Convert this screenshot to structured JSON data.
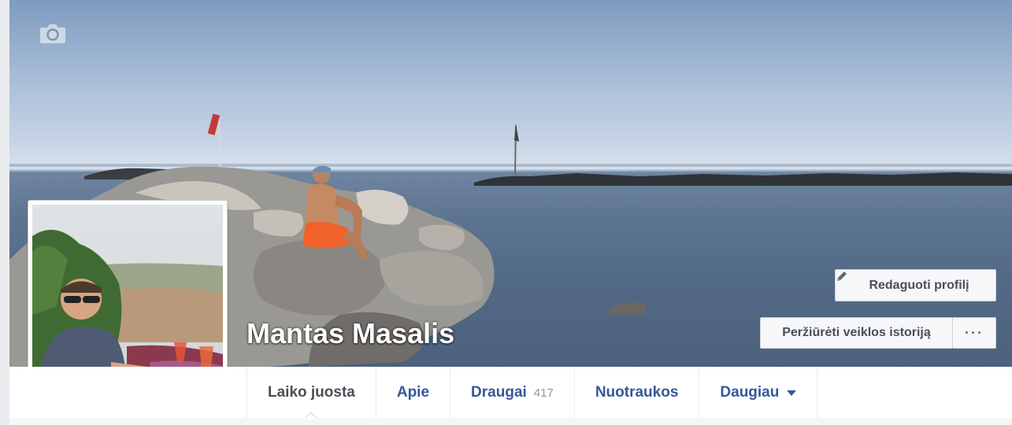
{
  "profile": {
    "name": "Mantas Masalis"
  },
  "cover": {
    "camera_icon": "camera-icon"
  },
  "actions": {
    "edit_profile_label": "Redaguoti profilį",
    "edit_icon": "pencil-icon",
    "activity_log_label": "Peržiūrėti veiklos istoriją",
    "more_label": "···"
  },
  "tabs": [
    {
      "label": "Laiko juosta",
      "active": true
    },
    {
      "label": "Apie"
    },
    {
      "label": "Draugai",
      "count": "417"
    },
    {
      "label": "Nuotraukos"
    },
    {
      "label": "Daugiau",
      "caret": "chevron-down-icon"
    }
  ],
  "colors": {
    "link": "#365899",
    "active_tab": "#4b4f56",
    "button_bg": "#f6f7f9"
  }
}
